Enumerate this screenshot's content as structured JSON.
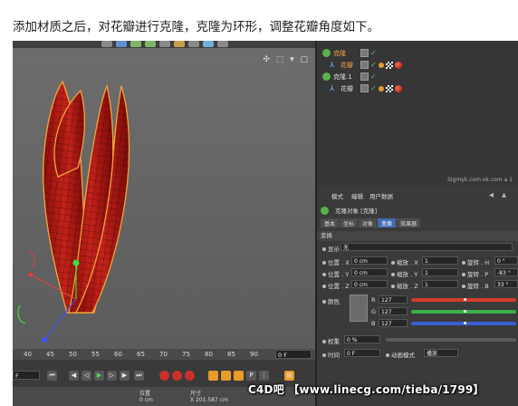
{
  "caption": "添加材质之后，对花瓣进行克隆，克隆为环形，调整花瓣角度如下。",
  "viewport": {
    "nav_icons": "✣ ⬚ ▾ ▢"
  },
  "object_manager": {
    "rows": [
      {
        "label": "克隆",
        "icon": "cloner-icon",
        "selected": true
      },
      {
        "label": "花瓣",
        "icon": "null-icon",
        "selected": true
      },
      {
        "label": "克隆.1",
        "icon": "cloner-icon",
        "selected": false
      },
      {
        "label": "花瓣",
        "icon": "null-icon",
        "selected": false
      }
    ],
    "small_watermark": "Sigmyk.com ok.com a 1"
  },
  "attributes": {
    "menu": [
      "模式",
      "编辑",
      "用户数据"
    ],
    "object_title": "克隆对象 [克隆]",
    "tabs": [
      "基本",
      "坐标",
      "对象",
      "变换",
      "效果器"
    ],
    "active_tab": "变换",
    "section_title": "变换",
    "display_label": "显示",
    "display_value": "无",
    "rows": [
      {
        "pos_label": "位置 . X",
        "pos_value": "0 cm",
        "scale_label": "缩放 . X",
        "scale_value": "1",
        "rot_label": "旋转 . H",
        "rot_value": "0 °"
      },
      {
        "pos_label": "位置 . Y",
        "pos_value": "0 cm",
        "scale_label": "缩放 . Y",
        "scale_value": "1",
        "rot_label": "旋转 . P",
        "rot_value": "-83 °"
      },
      {
        "pos_label": "位置 . Z",
        "pos_value": "0 cm",
        "scale_label": "缩放 . Z",
        "scale_value": "1",
        "rot_label": "旋转 . B",
        "rot_value": "33 °"
      }
    ],
    "color_label": "颜色",
    "color_channels": [
      {
        "ch": "R",
        "value": "127",
        "color": "#d23b2a"
      },
      {
        "ch": "G",
        "value": "127",
        "color": "#3bb04a"
      },
      {
        "ch": "B",
        "value": "127",
        "color": "#3b5fd2"
      }
    ],
    "weight_label": "权重",
    "weight_value": "0 %",
    "time_label": "时间",
    "time_value": "0 F",
    "anim_label": "动画模式",
    "anim_value": "播放"
  },
  "timeline": {
    "ticks": [
      "40",
      "45",
      "50",
      "55",
      "60",
      "65",
      "70",
      "75",
      "80",
      "85",
      "90"
    ],
    "frame_end": "0 F",
    "frame_start": "F",
    "bottom": {
      "col1": "位置",
      "col2": "尺寸",
      "val1": "0 cm",
      "val2": "X  201.587 cm"
    }
  },
  "banner": "C4D吧 【www.linecg.com/tieba/1799】"
}
